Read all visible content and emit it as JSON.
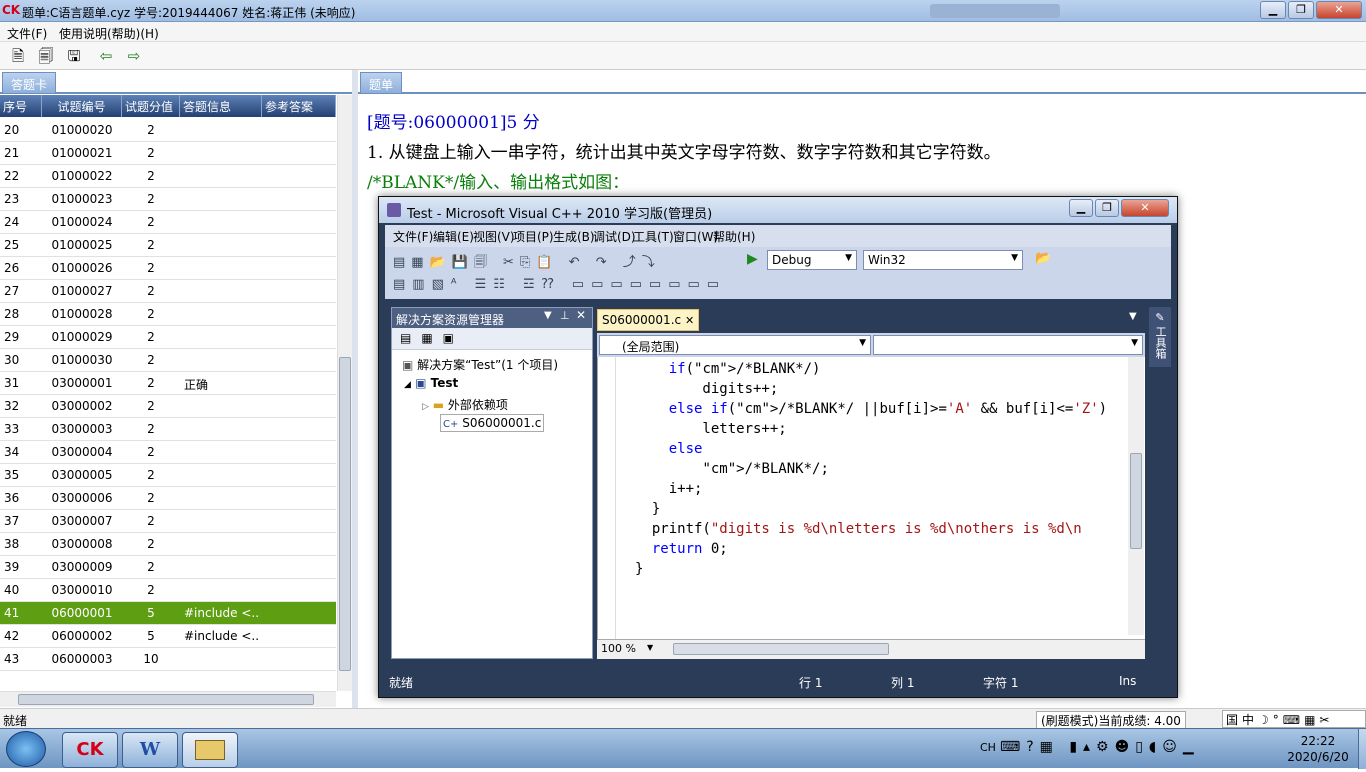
{
  "window": {
    "logo": "CK",
    "title": "题单:C语言题单.cyz  学号:2019444067 姓名:蒋正伟 (未响应)"
  },
  "menubar": [
    "文件(F)",
    "使用说明(帮助)(H)"
  ],
  "left_tab": "答题卡",
  "right_tab": "题单",
  "grid": {
    "columns": [
      "序号",
      "试题编号",
      "试题分值",
      "答题信息",
      "参考答案"
    ],
    "rows": [
      {
        "no": "20",
        "id": "01000020",
        "score": "2",
        "info": "",
        "ref": ""
      },
      {
        "no": "21",
        "id": "01000021",
        "score": "2",
        "info": "",
        "ref": ""
      },
      {
        "no": "22",
        "id": "01000022",
        "score": "2",
        "info": "",
        "ref": ""
      },
      {
        "no": "23",
        "id": "01000023",
        "score": "2",
        "info": "",
        "ref": ""
      },
      {
        "no": "24",
        "id": "01000024",
        "score": "2",
        "info": "",
        "ref": ""
      },
      {
        "no": "25",
        "id": "01000025",
        "score": "2",
        "info": "",
        "ref": ""
      },
      {
        "no": "26",
        "id": "01000026",
        "score": "2",
        "info": "",
        "ref": ""
      },
      {
        "no": "27",
        "id": "01000027",
        "score": "2",
        "info": "",
        "ref": ""
      },
      {
        "no": "28",
        "id": "01000028",
        "score": "2",
        "info": "",
        "ref": ""
      },
      {
        "no": "29",
        "id": "01000029",
        "score": "2",
        "info": "",
        "ref": ""
      },
      {
        "no": "30",
        "id": "01000030",
        "score": "2",
        "info": "",
        "ref": ""
      },
      {
        "no": "31",
        "id": "03000001",
        "score": "2",
        "info": "正确",
        "ref": ""
      },
      {
        "no": "32",
        "id": "03000002",
        "score": "2",
        "info": "",
        "ref": ""
      },
      {
        "no": "33",
        "id": "03000003",
        "score": "2",
        "info": "",
        "ref": ""
      },
      {
        "no": "34",
        "id": "03000004",
        "score": "2",
        "info": "",
        "ref": ""
      },
      {
        "no": "35",
        "id": "03000005",
        "score": "2",
        "info": "",
        "ref": ""
      },
      {
        "no": "36",
        "id": "03000006",
        "score": "2",
        "info": "",
        "ref": ""
      },
      {
        "no": "37",
        "id": "03000007",
        "score": "2",
        "info": "",
        "ref": ""
      },
      {
        "no": "38",
        "id": "03000008",
        "score": "2",
        "info": "",
        "ref": ""
      },
      {
        "no": "39",
        "id": "03000009",
        "score": "2",
        "info": "",
        "ref": ""
      },
      {
        "no": "40",
        "id": "03000010",
        "score": "2",
        "info": "",
        "ref": ""
      },
      {
        "no": "41",
        "id": "06000001",
        "score": "5",
        "info": "#include <...",
        "ref": ""
      },
      {
        "no": "42",
        "id": "06000002",
        "score": "5",
        "info": "#include <...",
        "ref": ""
      },
      {
        "no": "43",
        "id": "06000003",
        "score": "10",
        "info": "",
        "ref": ""
      }
    ],
    "selected_row": "41",
    "selected_color": "#5e9e12"
  },
  "question": {
    "header": "[题号:06000001]5 分",
    "text": "1. 从键盘上输入一串字符，统计出其中英文字母字符数、数字字符数和其它字符数。",
    "blank": "/*BLANK*/输入、输出格式如图："
  },
  "vs": {
    "title": "Test - Microsoft Visual C++ 2010 学习版(管理员)",
    "menus": [
      "文件(F)",
      "编辑(E)",
      "视图(V)",
      "项目(P)",
      "生成(B)",
      "调试(D)",
      "工具(T)",
      "窗口(W)",
      "帮助(H)"
    ],
    "config": "Debug",
    "platform": "Win32",
    "solution_panel_title": "解决方案资源管理器",
    "solution_label": "解决方案“Test”(1 个项目)",
    "project": "Test",
    "external_deps": "外部依赖项",
    "file": "S06000001.c",
    "editor_tab": "S06000001.c",
    "scope": "(全局范围)",
    "code_lines": [
      "    if(/*BLANK*/)",
      "        digits++;",
      "    else if(/*BLANK*/ ||buf[i]>='A' && buf[i]<='Z')",
      "        letters++;",
      "    else",
      "        /*BLANK*/;",
      "    i++;",
      "  }",
      "  printf(\"digits is %d\\nletters is %d\\nothers is %d\\n",
      "  return 0;",
      "}"
    ],
    "zoom": "100 %",
    "toolbox_label": "工具箱",
    "status": {
      "ready": "就绪",
      "row": "行 1",
      "col": "列 1",
      "char": "字符 1",
      "mode": "Ins"
    }
  },
  "statusbar": {
    "left": "就绪",
    "right": "(刷题模式)当前成绩: 4.00"
  },
  "taskbar": {
    "apps": [
      "CK",
      "W"
    ],
    "lang": "CH",
    "time": "22:22",
    "date": "2020/6/20"
  }
}
